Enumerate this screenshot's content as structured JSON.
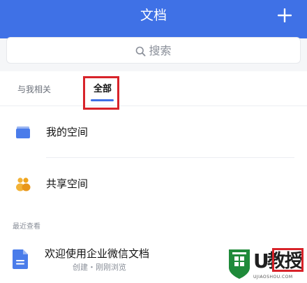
{
  "header": {
    "title": "文档"
  },
  "search": {
    "placeholder": "搜索"
  },
  "tabs": [
    {
      "label": "与我相关",
      "active": false
    },
    {
      "label": "全部",
      "active": true
    }
  ],
  "spaces": [
    {
      "label": "我的空间",
      "icon": "folder-icon"
    },
    {
      "label": "共享空间",
      "icon": "people-icon"
    }
  ],
  "recent": {
    "section_label": "最近查看",
    "items": [
      {
        "title": "欢迎使用企业微信文档",
        "subtitle": "创建・刚刚浏览",
        "icon": "document-icon"
      }
    ]
  },
  "watermark": {
    "brand": "U教授",
    "letter": "U",
    "word": "教授",
    "domain": "UJIAOSHOU.COM"
  },
  "colors": {
    "accent": "#3f71e6",
    "highlight": "#d8232a",
    "background": "#f5f6f8"
  }
}
